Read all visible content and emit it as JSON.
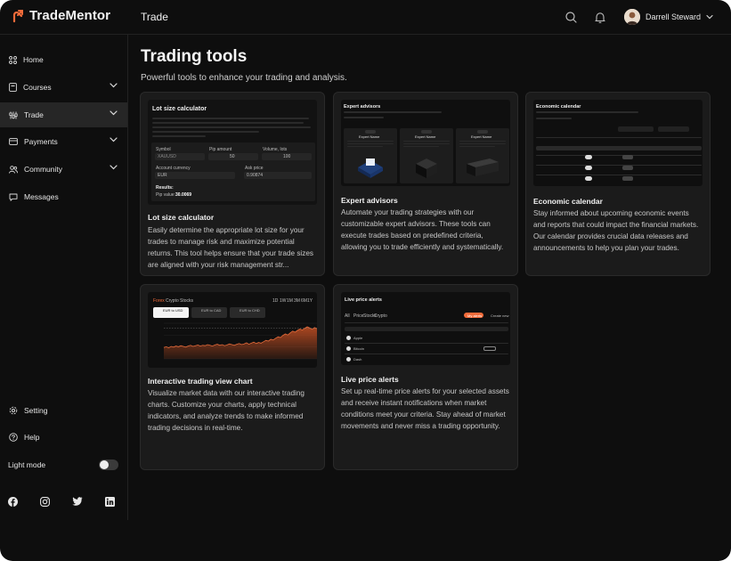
{
  "app": {
    "name": "TradeMentor",
    "section": "Trade"
  },
  "user": {
    "name": "Darrell Steward"
  },
  "sidebar": {
    "items": [
      {
        "label": "Home"
      },
      {
        "label": "Courses"
      },
      {
        "label": "Trade"
      },
      {
        "label": "Payments"
      },
      {
        "label": "Community"
      },
      {
        "label": "Messages"
      }
    ],
    "bottom": [
      {
        "label": "Setting"
      },
      {
        "label": "Help"
      },
      {
        "label": "Light mode"
      }
    ]
  },
  "page": {
    "title": "Trading tools",
    "subtitle": "Powerful tools to enhance your trading and analysis."
  },
  "cards": [
    {
      "title": "Lot size calculator",
      "desc": "Easily determine the appropriate lot size for your trades to manage risk and maximize potential returns. This tool helps ensure that your trade sizes are aligned with your risk management str..."
    },
    {
      "title": "Expert advisors",
      "desc": "Automate your trading strategies with our customizable expert advisors. These tools can execute trades based on predefined criteria, allowing you to trade efficiently and systematically."
    },
    {
      "title": "Economic calendar",
      "desc": "Stay informed about upcoming economic events and reports that could impact the financial markets. Our calendar provides crucial data releases and announcements to help you plan your trades."
    },
    {
      "title": "Interactive trading view chart",
      "desc": "Visualize market data with our interactive trading charts. Customize your charts, apply technical indicators, and analyze trends to make informed trading decisions in real-time."
    },
    {
      "title": "Live price alerts",
      "desc": "Set up real-time price alerts for your selected assets and receive instant notifications when market conditions meet your criteria. Stay ahead of market movements and never miss a trading opportunity."
    }
  ],
  "previews": {
    "lot": {
      "title": "Lot size calculator",
      "symbol_label": "Symbol",
      "symbol": "XAUUSD",
      "pip_label": "Pip amount",
      "pip": "50",
      "volume_label": "Volume, lots",
      "volume": "100",
      "currency_label": "Account currency",
      "currency": "EUR",
      "ask_label": "Ask price",
      "ask": "0.90874",
      "results_label": "Results:",
      "pip_value_label": "Pip value:",
      "pip_value": "30.0069"
    },
    "ea": {
      "title": "Expert advisors",
      "cards": [
        "Expert Name",
        "Expert Name",
        "Expert Name"
      ]
    },
    "econ": {
      "title": "Economic calendar"
    },
    "chart": {
      "tabs": [
        "Forex",
        "Crypto",
        "Stocks"
      ],
      "tickers": [
        "EUR to USD",
        "EUR to CAD",
        "EUR to CHD"
      ],
      "timeframes": [
        "1D",
        "1W",
        "1M",
        "3M",
        "6M",
        "1Y",
        "All"
      ]
    },
    "alerts": {
      "title": "Live price alerts",
      "tabs": [
        "All",
        "Price",
        "Stocks",
        "Crypto"
      ],
      "tab_active": "My alerts",
      "tab_other": "Create new",
      "rows": [
        "Apple",
        "Bitcoin",
        "Dash"
      ]
    }
  },
  "chart_data": {
    "type": "area",
    "series": [
      {
        "values": [
          0.32,
          0.34,
          0.31,
          0.35,
          0.33,
          0.36,
          0.34,
          0.37,
          0.35,
          0.33,
          0.36,
          0.38,
          0.35,
          0.37,
          0.39,
          0.36,
          0.38,
          0.37,
          0.4,
          0.38,
          0.36,
          0.39,
          0.41,
          0.38,
          0.4,
          0.37,
          0.39,
          0.42,
          0.4,
          0.38,
          0.41,
          0.43,
          0.4,
          0.42,
          0.45,
          0.41,
          0.44,
          0.47,
          0.43,
          0.46,
          0.44,
          0.48,
          0.52,
          0.5,
          0.55,
          0.53,
          0.58,
          0.62,
          0.6,
          0.66,
          0.7,
          0.67,
          0.73,
          0.78,
          0.75,
          0.8,
          0.84,
          0.81,
          0.86,
          0.9,
          0.87,
          0.83,
          0.88,
          0.85
        ]
      }
    ],
    "colors": {
      "line": "#e46a3a",
      "fill": "#b34a22"
    }
  },
  "colors": {
    "accent": "#f26b3a",
    "bg": "#0e0e0e",
    "card": "#1b1b1b"
  }
}
